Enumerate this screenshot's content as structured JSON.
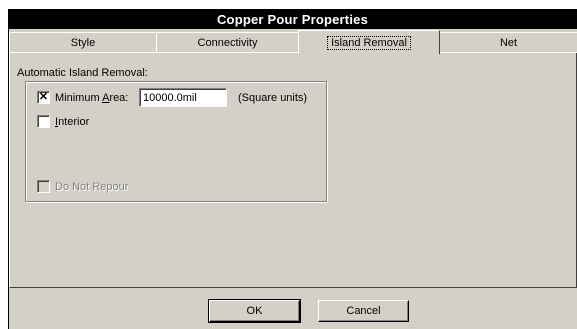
{
  "window": {
    "title": "Copper Pour Properties"
  },
  "tabs": [
    {
      "label": "Style",
      "active": false
    },
    {
      "label": "Connectivity",
      "active": false
    },
    {
      "label": "Island Removal",
      "active": true
    },
    {
      "label": "Net",
      "active": false
    }
  ],
  "island_removal": {
    "group_label": "Automatic Island Removal:",
    "minimum_area": {
      "checked": true,
      "check_mark": "✕",
      "label_prefix": "Minimum ",
      "label_hotkey": "A",
      "label_suffix": "rea:",
      "value": "10000.0mil",
      "units": "(Square units)"
    },
    "interior": {
      "checked": false,
      "label_hotkey": "I",
      "label_suffix": "nterior"
    },
    "do_not_repour": {
      "checked": false,
      "enabled": false,
      "label": "Do Not Repour"
    }
  },
  "buttons": {
    "ok": "OK",
    "cancel": "Cancel"
  }
}
